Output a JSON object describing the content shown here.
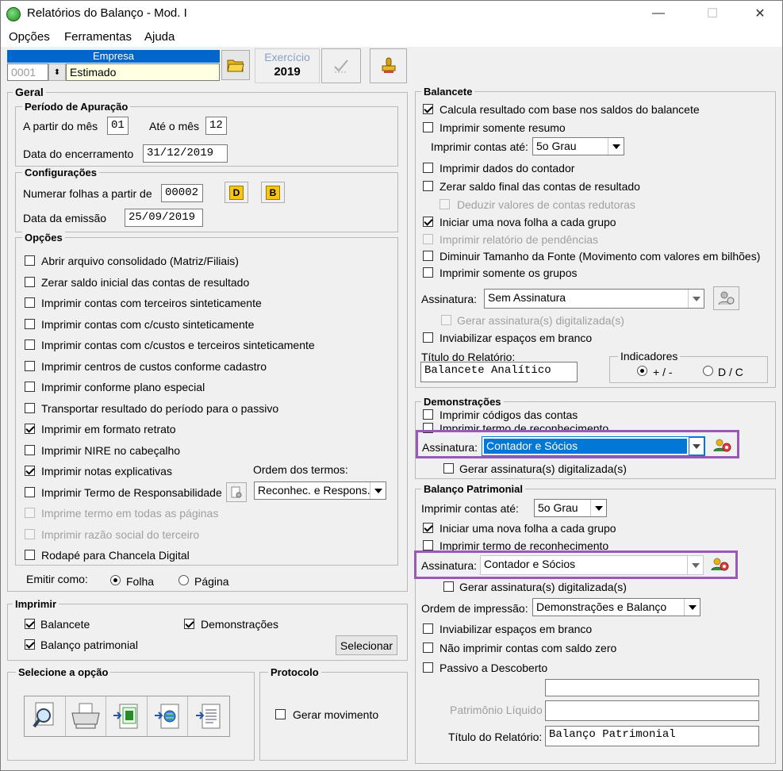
{
  "window": {
    "title": "Relatórios do Balanço - Mod. I",
    "min": "—",
    "max": "☐",
    "close": "✕"
  },
  "menu": {
    "opcoes": "Opções",
    "ferramentas": "Ferramentas",
    "ajuda": "Ajuda"
  },
  "empresa": {
    "header": "Empresa",
    "code": "0001",
    "name": "Estimado"
  },
  "exercicio": {
    "label": "Exercício",
    "year": "2019"
  },
  "geral": {
    "title": "Geral",
    "periodo": {
      "title": "Período de Apuração",
      "a_partir": "A partir do mês",
      "mes_ini": "01",
      "ate": "Até o mês",
      "mes_fim": "12",
      "encerramento_label": "Data do encerramento",
      "encerramento": "31/12/2019"
    },
    "config": {
      "title": "Configurações",
      "numerar_label": "Numerar folhas a partir de",
      "numerar": "00002",
      "btn_d": "D",
      "btn_b": "B",
      "emissao_label": "Data da emissão",
      "emissao": "25/09/2019"
    },
    "opcoes": {
      "title": "Opções",
      "items": [
        {
          "label": "Abrir arquivo consolidado (Matriz/Filiais)",
          "checked": false,
          "disabled": false
        },
        {
          "label": "Zerar saldo inicial das contas de resultado",
          "checked": false,
          "disabled": false
        },
        {
          "label": "Imprimir contas com terceiros sinteticamente",
          "checked": false,
          "disabled": false
        },
        {
          "label": "Imprimir contas com c/custo sinteticamente",
          "checked": false,
          "disabled": false
        },
        {
          "label": "Imprimir contas com c/custos e terceiros sinteticamente",
          "checked": false,
          "disabled": false
        },
        {
          "label": "Imprimir centros de custos conforme cadastro",
          "checked": false,
          "disabled": false
        },
        {
          "label": "Imprimir conforme plano especial",
          "checked": false,
          "disabled": false
        },
        {
          "label": "Transportar resultado do período para o passivo",
          "checked": false,
          "disabled": false
        },
        {
          "label": "Imprimir em formato retrato",
          "checked": true,
          "disabled": false
        },
        {
          "label": "Imprimir NIRE no cabeçalho",
          "checked": false,
          "disabled": false
        },
        {
          "label": "Imprimir notas explicativas",
          "checked": true,
          "disabled": false
        },
        {
          "label": "Imprimir Termo de Responsabilidade",
          "checked": false,
          "disabled": false
        },
        {
          "label": "Imprime termo em todas as páginas",
          "checked": false,
          "disabled": true
        },
        {
          "label": "Imprimir razão social do terceiro",
          "checked": false,
          "disabled": true
        },
        {
          "label": "Rodapé para Chancela Digital",
          "checked": false,
          "disabled": false
        }
      ],
      "ordem_label": "Ordem dos termos:",
      "ordem_value": "Reconhec. e Respons."
    },
    "emitir": {
      "label": "Emitir como:",
      "folha": "Folha",
      "pagina": "Página"
    }
  },
  "imprimir": {
    "title": "Imprimir",
    "balancete": "Balancete",
    "demonstracoes": "Demonstrações",
    "balanco": "Balanço patrimonial",
    "selecionar": "Selecionar"
  },
  "selecione": {
    "title": "Selecione a opção"
  },
  "protocolo": {
    "title": "Protocolo",
    "gerar": "Gerar movimento"
  },
  "balancete": {
    "title": "Balancete",
    "calcula": "Calcula resultado com base nos saldos do balancete",
    "somente_resumo": "Imprimir somente resumo",
    "contas_ate_label": "Imprimir contas até:",
    "contas_ate": "5o Grau",
    "dados_contador": "Imprimir dados do contador",
    "zerar_saldo": "Zerar saldo final das contas de resultado",
    "deduzir": "Deduzir valores de contas redutoras",
    "nova_folha": "Iniciar uma nova folha a cada grupo",
    "pendencias": "Imprimir relatório de pendências",
    "diminuir": "Diminuir Tamanho da Fonte (Movimento com valores em bilhões)",
    "somente_grupos": "Imprimir somente os grupos",
    "assinatura_label": "Assinatura:",
    "assinatura": "Sem Assinatura",
    "gerar_assinatura": "Gerar assinatura(s) digitalizada(s)",
    "inviabilizar": "Inviabilizar espaços em branco",
    "titulo_label": "Título do Relatório:",
    "titulo": "Balancete Analítico",
    "indicadores": "Indicadores",
    "ind_mais": "+ / -",
    "ind_dc": "D / C"
  },
  "demonstracoes": {
    "title": "Demonstrações",
    "codigos": "Imprimir códigos das contas",
    "termo": "Imprimir termo de reconhecimento",
    "assinatura_label": "Assinatura:",
    "assinatura": "Contador e Sócios",
    "gerar_assinatura": "Gerar assinatura(s) digitalizada(s)"
  },
  "balanco": {
    "title": "Balanço Patrimonial",
    "contas_ate_label": "Imprimir contas até:",
    "contas_ate": "5o Grau",
    "nova_folha": "Iniciar uma nova folha a cada grupo",
    "termo": "Imprimir termo de reconhecimento",
    "assinatura_label": "Assinatura:",
    "assinatura": "Contador e Sócios",
    "gerar_assinatura": "Gerar assinatura(s) digitalizada(s)",
    "ordem_label": "Ordem de impressão:",
    "ordem": "Demonstrações e Balanço",
    "inviabilizar": "Inviabilizar espaços em branco",
    "nao_imprimir_zero": "Não imprimir contas com saldo zero",
    "passivo_descoberto": "Passivo a Descoberto",
    "patrimonio_label": "Patrimônio Líquido",
    "patrimonio": "",
    "extra": "",
    "titulo_label": "Título do Relatório:",
    "titulo": "Balanço Patrimonial"
  },
  "colors": {
    "highlight": "#9b59b6",
    "selection": "#0078d7",
    "empresa_bg": "#ffffe1"
  }
}
